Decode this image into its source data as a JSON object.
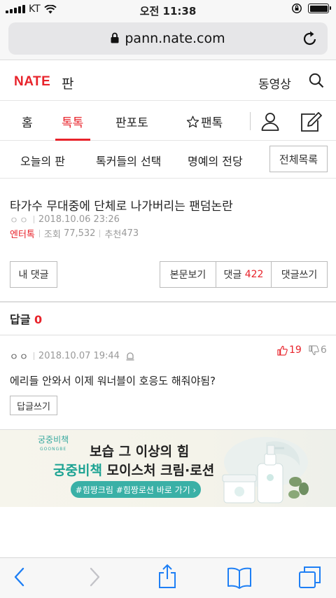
{
  "status_bar": {
    "carrier": "KT",
    "time": "오전 11:38"
  },
  "browser": {
    "url": "pann.nate.com"
  },
  "header": {
    "logo": "NATE",
    "section": "판",
    "video_label": "동영상"
  },
  "main_nav": {
    "items": [
      {
        "label": "홈",
        "active": false
      },
      {
        "label": "톡톡",
        "active": true
      },
      {
        "label": "판포토",
        "active": false
      },
      {
        "label": "팬톡",
        "active": false
      }
    ]
  },
  "sub_nav": {
    "items": [
      "오늘의 판",
      "톡커들의 선택",
      "명예의 전당"
    ],
    "all_list_button": "전체목록"
  },
  "article": {
    "title": "타가수 무대중에 단체로 나가버리는 팬덤논란",
    "author": "ㅇㅇ",
    "date": "2018.10.06 23:26",
    "category": "엔터톡",
    "views_label": "조회",
    "views": "77,532",
    "recommend_label": "추천",
    "recommend": "473"
  },
  "actions": {
    "my_comments": "내 댓글",
    "view_body": "본문보기",
    "comments_label": "댓글",
    "comments_count": "422",
    "write_comment": "댓글쓰기"
  },
  "replies": {
    "label": "답글",
    "count": "0"
  },
  "comment": {
    "author": "ㅇㅇ",
    "date": "2018.10.07 19:44",
    "likes": "19",
    "dislikes": "6",
    "text": "에리들 안와서 이제 워너블이 호응도 해줘야됨?",
    "reply_button": "답글쓰기"
  },
  "ad": {
    "brand": "궁중비책",
    "brand_en": "GOONGBE",
    "line1": "보습 그 이상의 힘",
    "line2_brand": "궁중비책",
    "line2_rest": " 모이스처 크림·로션",
    "pill": "#힘짱크림 #힘짱로션 바로 가기  ›"
  },
  "colors": {
    "accent": "#e8232b",
    "teal": "#1da393"
  }
}
